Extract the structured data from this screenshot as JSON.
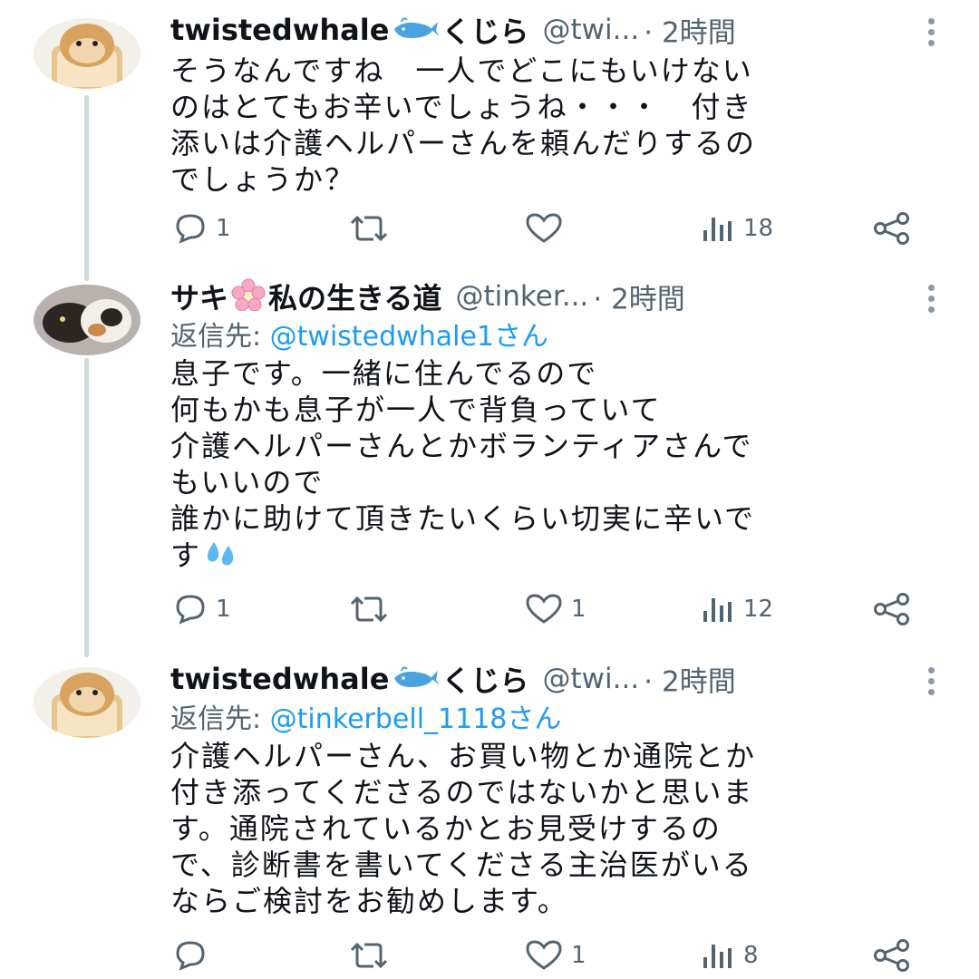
{
  "tweets": [
    {
      "author_name": "twistedwhale",
      "author_suffix": "くじら",
      "emoji": "whale-emoji",
      "handle": "@twi...",
      "time": "· 2時間",
      "reply_prefix": "",
      "reply_to": "",
      "reply_suffix": "",
      "text": "そうなんですね　一人でどこにもいけない\nのはとてもお辛いでしょうね・・・　付き\n添いは介護ヘルパーさんを頼んだりするの\nでしょうか？",
      "stats": {
        "replies": "1",
        "retweets": "",
        "likes": "",
        "views": "18"
      }
    },
    {
      "author_name": "サキ",
      "author_suffix": "私の生きる道",
      "emoji": "cherry-blossom-emoji",
      "handle": "@tinker...",
      "time": "· 2時間",
      "reply_prefix": "返信先: ",
      "reply_to": "@twistedwhale1さん",
      "reply_suffix": "",
      "text": "息子です。一緒に住んでるので\n何もかも息子が一人で背負っていて\n介護ヘルパーさんとかボランティアさんで\nもいいので\n誰かに助けて頂きたいくらい切実に辛いで\nす",
      "stats": {
        "replies": "1",
        "retweets": "",
        "likes": "1",
        "views": "12"
      }
    },
    {
      "author_name": "twistedwhale",
      "author_suffix": "くじら",
      "emoji": "whale-emoji",
      "handle": "@twi...",
      "time": "· 2時間",
      "reply_prefix": "返信先: ",
      "reply_to": "@tinkerbell_1118さん",
      "reply_suffix": "",
      "text": "介護ヘルパーさん、お買い物とか通院とか\n付き添ってくださるのではないかと思いま\nす。通院されているかとお見受けするの\nで、診断書を書いてくださる主治医がいる\nならご検討をお勧めします。",
      "stats": {
        "replies": "",
        "retweets": "",
        "likes": "1",
        "views": "8"
      }
    }
  ],
  "colors": {
    "link": "#1d9bf0",
    "muted": "#536471",
    "thread": "#cfd9de"
  }
}
